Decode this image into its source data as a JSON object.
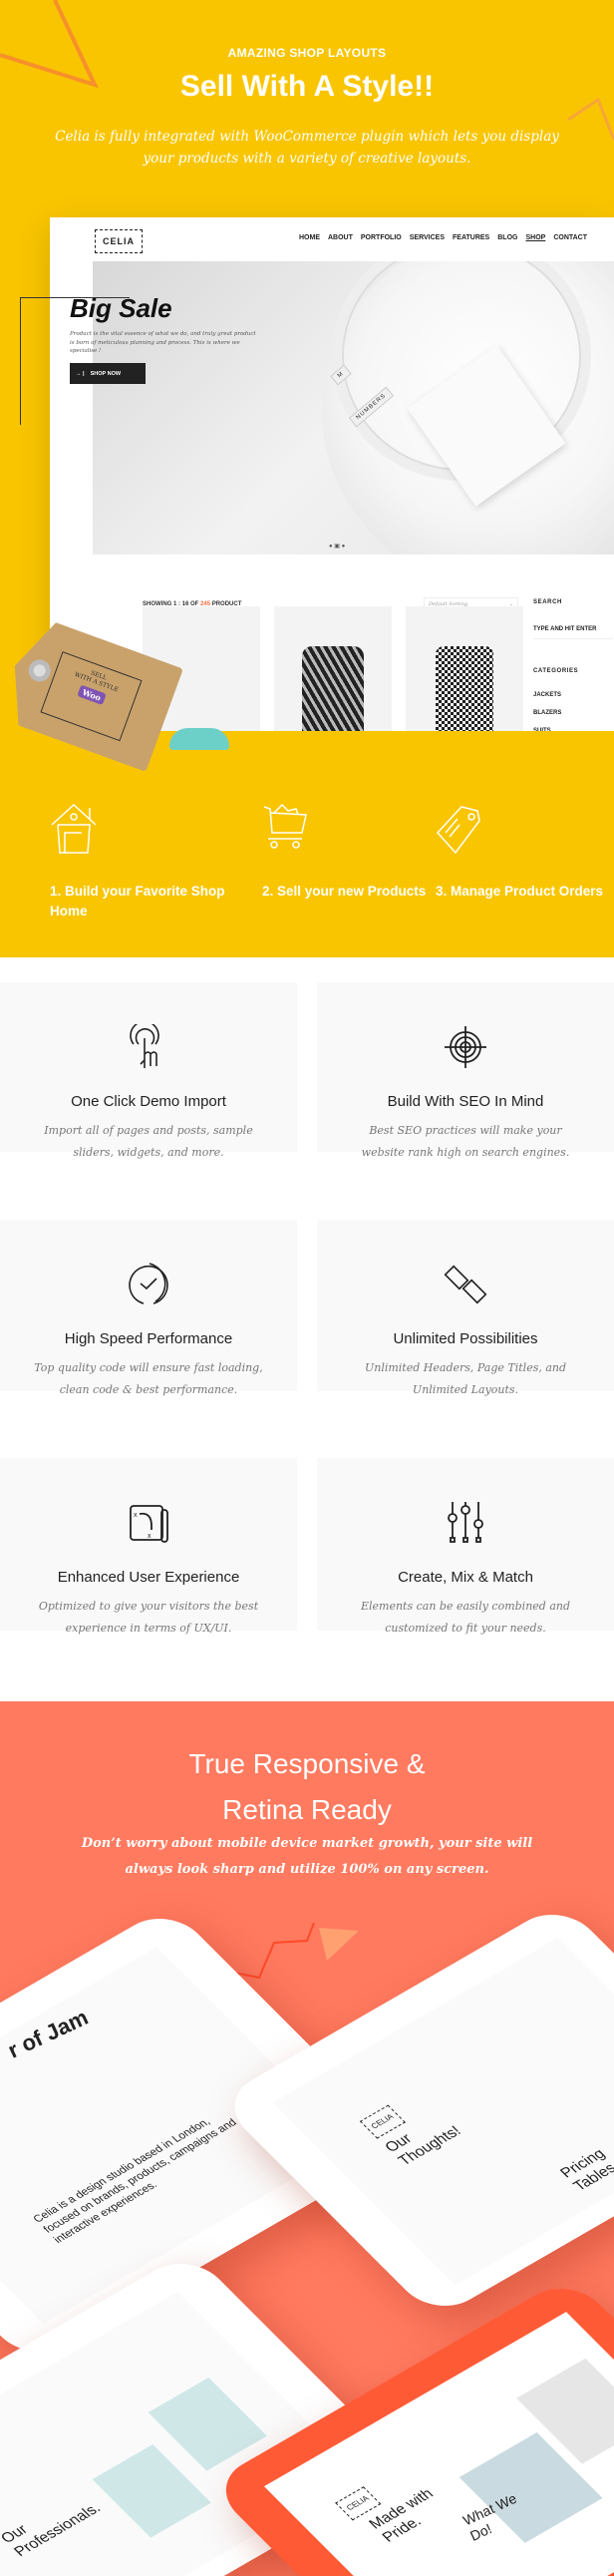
{
  "shop_section": {
    "kicker": "AMAZING SHOP LAYOUTS",
    "title": "Sell With A Style!!",
    "subtitle": "Celia is fully integrated with WooCommerce plugin which lets you display your products with a variety of creative layouts.",
    "background_color": "#F9C500"
  },
  "mockup": {
    "logo": "CELIA",
    "nav": [
      "HOME",
      "ABOUT",
      "PORTFOLIO",
      "SERVICES",
      "FEATURES",
      "BLOG",
      "SHOP",
      "CONTACT"
    ],
    "active_nav": "SHOP",
    "hero": {
      "title": "Big Sale",
      "description": "Product is the vital essence of what we do, and truly great product is born of meticulous planning and process. This is where we specialise !",
      "button": "SHOP NOW",
      "shirt_label": "NUMBERS",
      "size_label": "M"
    },
    "showing_prefix": "SHOWING 1 : 16 OF",
    "showing_count": "245",
    "showing_suffix": "PRODUCT",
    "sort_placeholder": "Default Sorting",
    "sidebar": {
      "search_title": "SEARCH",
      "search_placeholder": "TYPE AND HIT ENTER",
      "categories_title": "CATEGORIES",
      "categories": [
        "JACKETS",
        "BLAZERS",
        "SUITS"
      ]
    },
    "tag": {
      "line1": "SELL",
      "line2": "WITH A STYLE",
      "badge": "Woo"
    }
  },
  "steps": [
    {
      "icon": "house-icon",
      "label": "1. Build your Favorite Shop Home"
    },
    {
      "icon": "cart-icon",
      "label": "2. Sell your new Products"
    },
    {
      "icon": "price-tag-icon",
      "label": "3. Manage Product Orders"
    }
  ],
  "features": [
    {
      "icon": "tap-hand-icon",
      "title": "One Click Demo Import",
      "description": "Import all of pages and posts, sample sliders, widgets, and more."
    },
    {
      "icon": "target-icon",
      "title": "Build With SEO In Mind",
      "description": "Best SEO practices will make your website rank high on search engines."
    },
    {
      "icon": "speed-clock-icon",
      "title": "High Speed Performance",
      "description": "Top quality code will ensure fast loading, clean code & best performance."
    },
    {
      "icon": "link-chain-icon",
      "title": "Unlimited Possibilities",
      "description": "Unlimited Headers, Page Titles, and Unlimited Layouts."
    },
    {
      "icon": "map-icon",
      "title": "Enhanced User Experience",
      "description": "Optimized to give your visitors the best experience in terms of UX/UI."
    },
    {
      "icon": "sliders-icon",
      "title": "Create, Mix & Match",
      "description": "Elements can be easily combined and customized to fit your needs."
    }
  ],
  "responsive_section": {
    "title_line1": "True Responsive &",
    "title_line2": "Retina Ready",
    "subtitle": "Don’t worry about mobile device market growth, your site will always look sharp and utilize 100% on any screen.",
    "background_color": "#FF7A5F",
    "phone_screens": {
      "jam": "r of Jam",
      "studio": "Celia is a design studio based in London, focused on brands, products, campaigns and interactive experiences.",
      "thoughts": "Our Thoughts!",
      "pricing": "Pricing Tables.",
      "made": "Made with Pride.",
      "professionals": "Our Professionals.",
      "what": "What We Do!",
      "logo": "CELIA"
    }
  }
}
